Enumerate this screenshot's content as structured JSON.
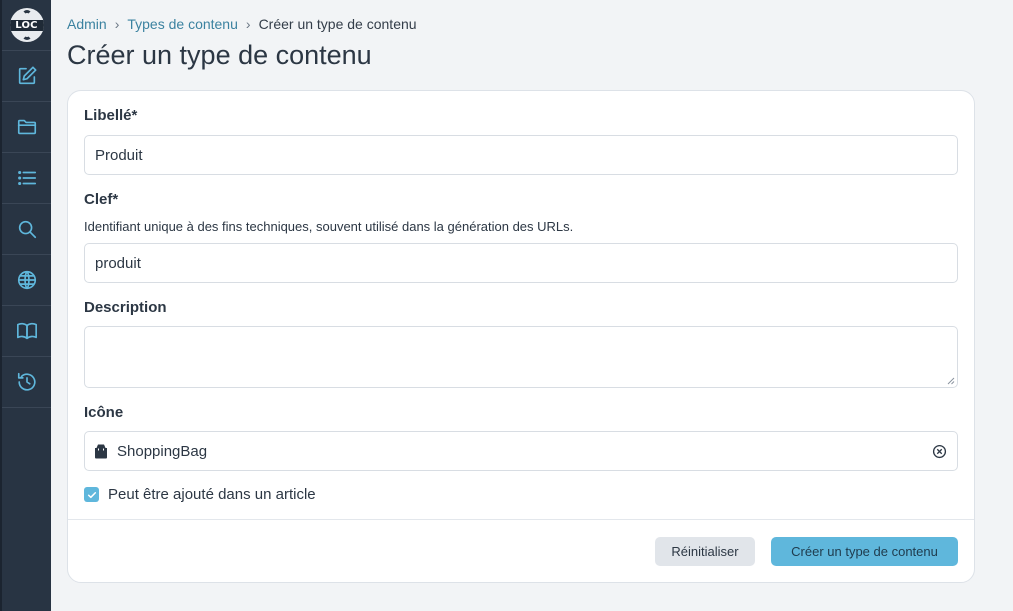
{
  "sidebar": {
    "logo_text": "LOC",
    "items": [
      {
        "icon": "edit-icon"
      },
      {
        "icon": "folder-icon"
      },
      {
        "icon": "list-icon"
      },
      {
        "icon": "search-icon"
      },
      {
        "icon": "globe-icon"
      },
      {
        "icon": "book-icon"
      },
      {
        "icon": "history-icon"
      }
    ],
    "accent_color": "#5fb7dc"
  },
  "breadcrumb": {
    "items": [
      "Admin",
      "Types de contenu"
    ],
    "current": "Créer un type de contenu",
    "separator": "›"
  },
  "page": {
    "title": "Créer un type de contenu"
  },
  "form": {
    "label_field": {
      "label": "Libellé*",
      "value": "Produit"
    },
    "key_field": {
      "label": "Clef*",
      "help": "Identifiant unique à des fins techniques, souvent utilisé dans la génération des URLs.",
      "value": "produit"
    },
    "description_field": {
      "label": "Description",
      "value": ""
    },
    "icon_field": {
      "label": "Icône",
      "value": "ShoppingBag",
      "icon": "shopping-bag-icon"
    },
    "checkbox": {
      "label": "Peut être ajouté dans un article",
      "checked": true
    },
    "reset_label": "Réinitialiser",
    "submit_label": "Créer un type de contenu"
  }
}
